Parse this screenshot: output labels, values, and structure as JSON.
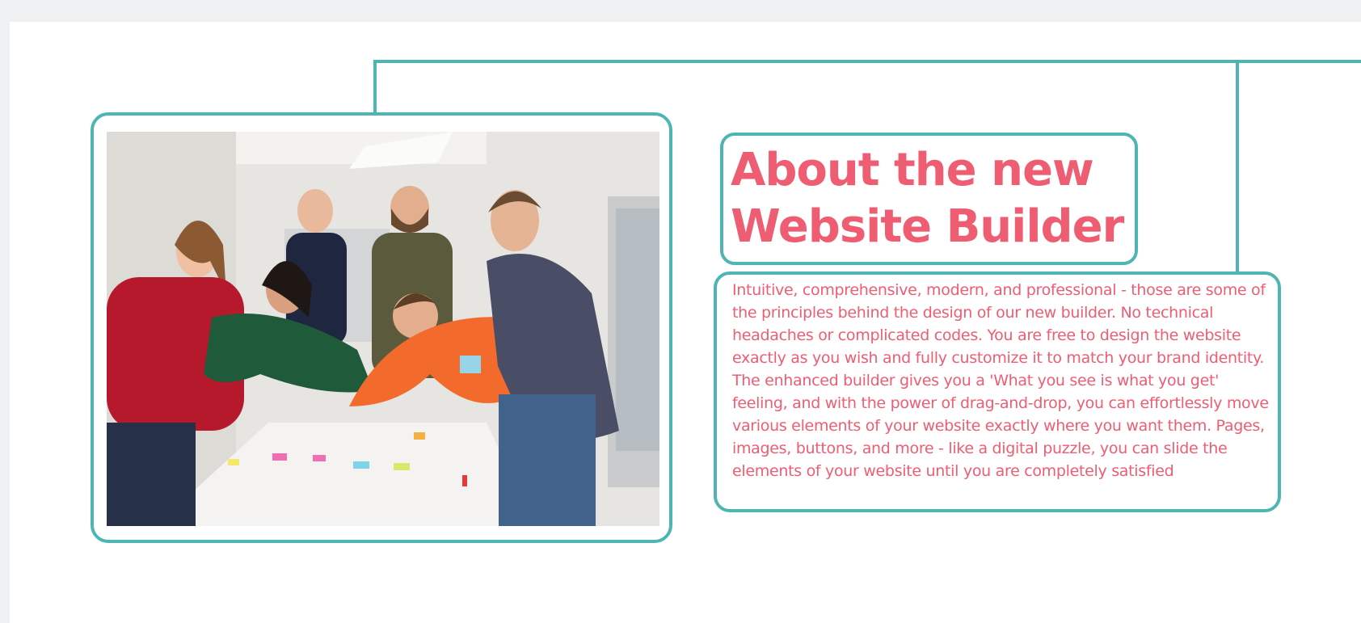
{
  "section": {
    "title": "About the new Website Builder",
    "body": "Intuitive, comprehensive, modern, and professional - those are some of the principles behind the design of our new builder. No technical headaches or complicated codes. You are free to design the website exactly as you wish and fully customize it to match your brand identity. The enhanced builder gives you a 'What you see is what you get' feeling, and with the power of drag-and-drop, you can effortlessly move various elements of your website exactly where you want them. Pages, images, buttons, and more - like a digital puzzle, you can slide the elements of your website until you are completely satisfied"
  },
  "colors": {
    "accent": "#4fb5b3",
    "text": "#ee5d72",
    "page_background": "#eef0f2",
    "canvas": "#ffffff"
  },
  "image": {
    "subject": "team-photo"
  }
}
